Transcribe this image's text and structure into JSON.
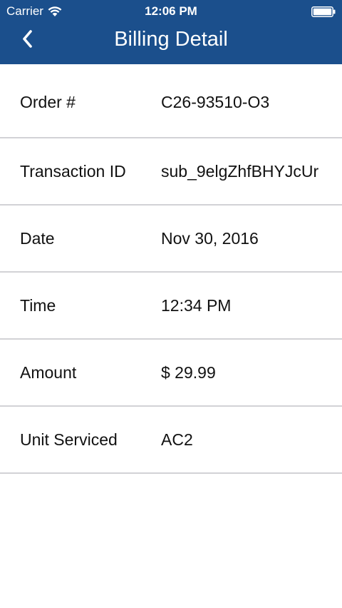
{
  "status_bar": {
    "carrier": "Carrier",
    "time": "12:06 PM"
  },
  "nav": {
    "back_icon": "chevron-left-icon",
    "title": "Billing Detail"
  },
  "colors": {
    "header_bg": "#1b4f8c",
    "divider": "#d2d2d6"
  },
  "details": [
    {
      "label": "Order #",
      "value": "C26-93510-O3"
    },
    {
      "label": "Transaction ID",
      "value": "sub_9elgZhfBHYJcUr"
    },
    {
      "label": "Date",
      "value": "Nov 30, 2016"
    },
    {
      "label": "Time",
      "value": "12:34 PM"
    },
    {
      "label": "Amount",
      "value": "$ 29.99"
    },
    {
      "label": "Unit Serviced",
      "value": "AC2"
    }
  ]
}
